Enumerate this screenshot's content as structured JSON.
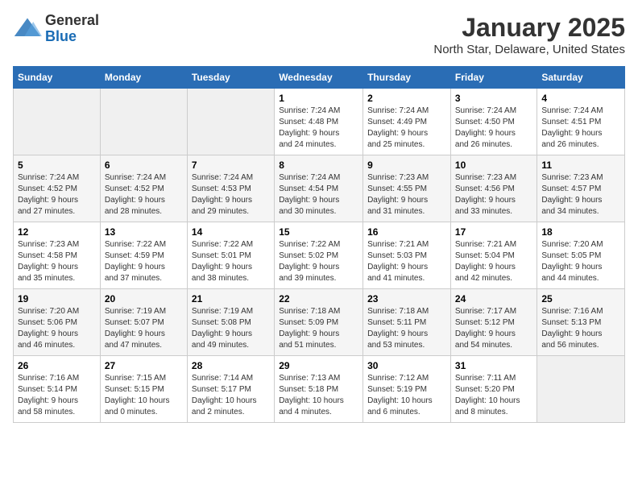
{
  "header": {
    "logo_general": "General",
    "logo_blue": "Blue",
    "title": "January 2025",
    "subtitle": "North Star, Delaware, United States"
  },
  "calendar": {
    "days_of_week": [
      "Sunday",
      "Monday",
      "Tuesday",
      "Wednesday",
      "Thursday",
      "Friday",
      "Saturday"
    ],
    "weeks": [
      [
        {
          "day": "",
          "info": ""
        },
        {
          "day": "",
          "info": ""
        },
        {
          "day": "",
          "info": ""
        },
        {
          "day": "1",
          "info": "Sunrise: 7:24 AM\nSunset: 4:48 PM\nDaylight: 9 hours\nand 24 minutes."
        },
        {
          "day": "2",
          "info": "Sunrise: 7:24 AM\nSunset: 4:49 PM\nDaylight: 9 hours\nand 25 minutes."
        },
        {
          "day": "3",
          "info": "Sunrise: 7:24 AM\nSunset: 4:50 PM\nDaylight: 9 hours\nand 26 minutes."
        },
        {
          "day": "4",
          "info": "Sunrise: 7:24 AM\nSunset: 4:51 PM\nDaylight: 9 hours\nand 26 minutes."
        }
      ],
      [
        {
          "day": "5",
          "info": "Sunrise: 7:24 AM\nSunset: 4:52 PM\nDaylight: 9 hours\nand 27 minutes."
        },
        {
          "day": "6",
          "info": "Sunrise: 7:24 AM\nSunset: 4:52 PM\nDaylight: 9 hours\nand 28 minutes."
        },
        {
          "day": "7",
          "info": "Sunrise: 7:24 AM\nSunset: 4:53 PM\nDaylight: 9 hours\nand 29 minutes."
        },
        {
          "day": "8",
          "info": "Sunrise: 7:24 AM\nSunset: 4:54 PM\nDaylight: 9 hours\nand 30 minutes."
        },
        {
          "day": "9",
          "info": "Sunrise: 7:23 AM\nSunset: 4:55 PM\nDaylight: 9 hours\nand 31 minutes."
        },
        {
          "day": "10",
          "info": "Sunrise: 7:23 AM\nSunset: 4:56 PM\nDaylight: 9 hours\nand 33 minutes."
        },
        {
          "day": "11",
          "info": "Sunrise: 7:23 AM\nSunset: 4:57 PM\nDaylight: 9 hours\nand 34 minutes."
        }
      ],
      [
        {
          "day": "12",
          "info": "Sunrise: 7:23 AM\nSunset: 4:58 PM\nDaylight: 9 hours\nand 35 minutes."
        },
        {
          "day": "13",
          "info": "Sunrise: 7:22 AM\nSunset: 4:59 PM\nDaylight: 9 hours\nand 37 minutes."
        },
        {
          "day": "14",
          "info": "Sunrise: 7:22 AM\nSunset: 5:01 PM\nDaylight: 9 hours\nand 38 minutes."
        },
        {
          "day": "15",
          "info": "Sunrise: 7:22 AM\nSunset: 5:02 PM\nDaylight: 9 hours\nand 39 minutes."
        },
        {
          "day": "16",
          "info": "Sunrise: 7:21 AM\nSunset: 5:03 PM\nDaylight: 9 hours\nand 41 minutes."
        },
        {
          "day": "17",
          "info": "Sunrise: 7:21 AM\nSunset: 5:04 PM\nDaylight: 9 hours\nand 42 minutes."
        },
        {
          "day": "18",
          "info": "Sunrise: 7:20 AM\nSunset: 5:05 PM\nDaylight: 9 hours\nand 44 minutes."
        }
      ],
      [
        {
          "day": "19",
          "info": "Sunrise: 7:20 AM\nSunset: 5:06 PM\nDaylight: 9 hours\nand 46 minutes."
        },
        {
          "day": "20",
          "info": "Sunrise: 7:19 AM\nSunset: 5:07 PM\nDaylight: 9 hours\nand 47 minutes."
        },
        {
          "day": "21",
          "info": "Sunrise: 7:19 AM\nSunset: 5:08 PM\nDaylight: 9 hours\nand 49 minutes."
        },
        {
          "day": "22",
          "info": "Sunrise: 7:18 AM\nSunset: 5:09 PM\nDaylight: 9 hours\nand 51 minutes."
        },
        {
          "day": "23",
          "info": "Sunrise: 7:18 AM\nSunset: 5:11 PM\nDaylight: 9 hours\nand 53 minutes."
        },
        {
          "day": "24",
          "info": "Sunrise: 7:17 AM\nSunset: 5:12 PM\nDaylight: 9 hours\nand 54 minutes."
        },
        {
          "day": "25",
          "info": "Sunrise: 7:16 AM\nSunset: 5:13 PM\nDaylight: 9 hours\nand 56 minutes."
        }
      ],
      [
        {
          "day": "26",
          "info": "Sunrise: 7:16 AM\nSunset: 5:14 PM\nDaylight: 9 hours\nand 58 minutes."
        },
        {
          "day": "27",
          "info": "Sunrise: 7:15 AM\nSunset: 5:15 PM\nDaylight: 10 hours\nand 0 minutes."
        },
        {
          "day": "28",
          "info": "Sunrise: 7:14 AM\nSunset: 5:17 PM\nDaylight: 10 hours\nand 2 minutes."
        },
        {
          "day": "29",
          "info": "Sunrise: 7:13 AM\nSunset: 5:18 PM\nDaylight: 10 hours\nand 4 minutes."
        },
        {
          "day": "30",
          "info": "Sunrise: 7:12 AM\nSunset: 5:19 PM\nDaylight: 10 hours\nand 6 minutes."
        },
        {
          "day": "31",
          "info": "Sunrise: 7:11 AM\nSunset: 5:20 PM\nDaylight: 10 hours\nand 8 minutes."
        },
        {
          "day": "",
          "info": ""
        }
      ]
    ]
  }
}
